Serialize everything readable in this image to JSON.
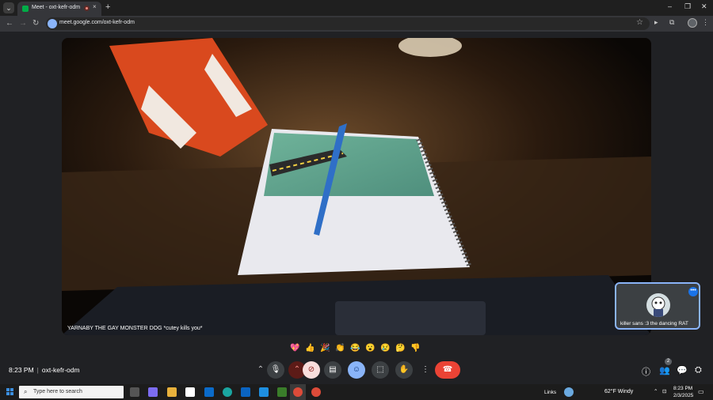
{
  "browser": {
    "tab_title": "Meet - oxt-kefr-odm",
    "tab_close": "×",
    "new_tab": "+",
    "url": "meet.google.com/oxt-kefr-odm",
    "min": "–",
    "max": "❐",
    "close": "✕"
  },
  "meeting": {
    "main_participant_name": "YARNABY THE GAY MONSTER DOG *cutey kills you*",
    "self_name": "killer sans :3 the dancing RAT",
    "time": "8:23 PM",
    "code": "oxt-kefr-odm",
    "participant_count": "2"
  },
  "reactions": [
    "💖",
    "👍",
    "🎉",
    "👏",
    "😂",
    "😮",
    "😢",
    "🤔",
    "👎"
  ],
  "taskbar": {
    "search_placeholder": "Type here to search",
    "links_label": "Links",
    "weather": "62°F  Windy",
    "clock_time": "8:23 PM",
    "clock_date": "2/3/2025"
  },
  "colors": {
    "end_call": "#ea4335",
    "accent": "#8ab4f8",
    "tile_border": "#8ab4f8"
  }
}
